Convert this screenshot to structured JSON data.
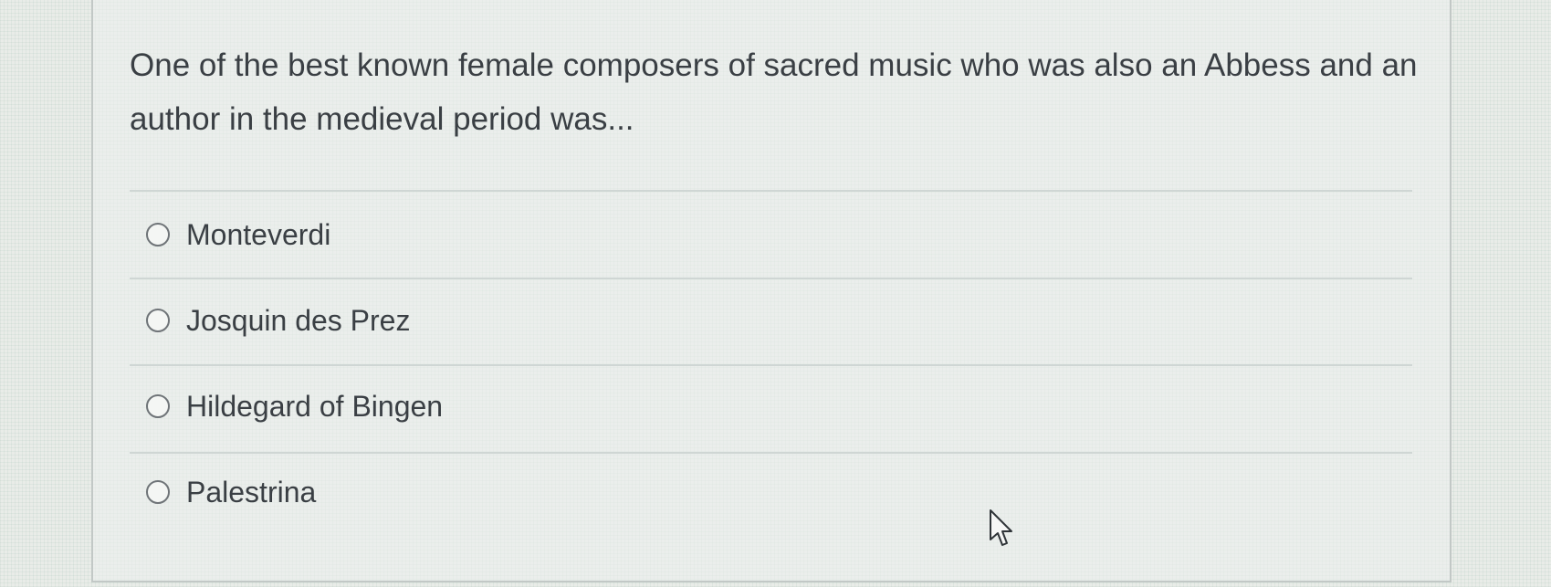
{
  "question": {
    "text": "One of the best known female composers of sacred music who was also an Abbess and an author in the medieval period was..."
  },
  "options": [
    {
      "label": "Monteverdi",
      "selected": false
    },
    {
      "label": "Josquin des Prez",
      "selected": false
    },
    {
      "label": "Hildegard of Bingen",
      "selected": false
    },
    {
      "label": "Palestrina",
      "selected": false
    }
  ],
  "icons": {
    "radio": "radio-button-icon",
    "cursor": "mouse-pointer-icon"
  },
  "colors": {
    "text": "#3a3f44",
    "divider": "#cfd6d4",
    "radio_border": "#6f7478"
  }
}
